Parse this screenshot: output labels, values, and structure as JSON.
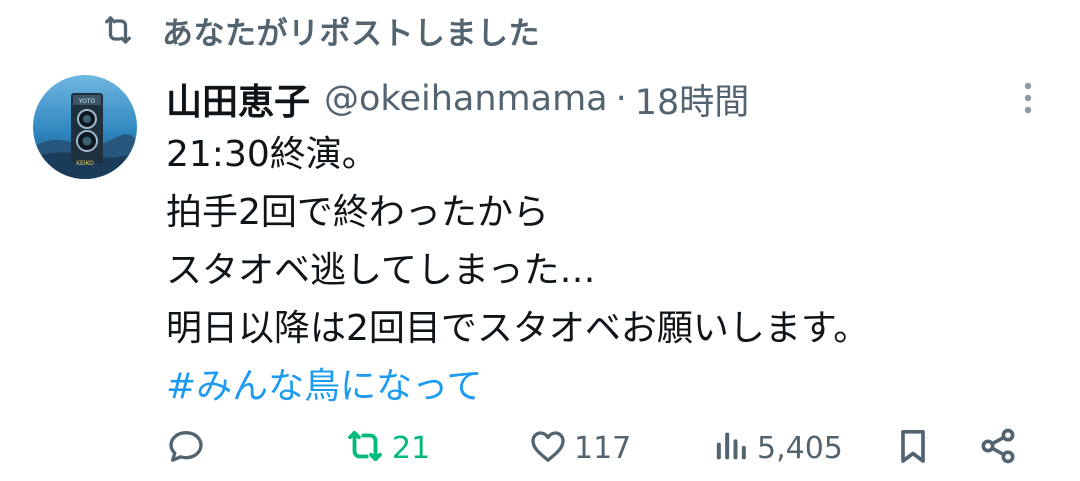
{
  "repost_banner": {
    "text": "あなたがリポストしました",
    "icon": "repost-icon"
  },
  "tweet": {
    "author": {
      "display_name": "山田恵子",
      "handle": "@okeihanmama",
      "avatar": "avatar-image"
    },
    "separator": "·",
    "time": "18時間",
    "lines": [
      "21:30終演。",
      "拍手2回で終わったから",
      "スタオベ逃してしまった…",
      "明日以降は2回目でスタオベお願いします。"
    ],
    "hashtag": "#みんな鳥になって",
    "more_icon": "more-vertical-icon"
  },
  "actions": {
    "reply": {
      "icon": "reply-icon",
      "count": ""
    },
    "retweet": {
      "icon": "retweet-icon",
      "count": "21",
      "active_color": "#00ba7c"
    },
    "like": {
      "icon": "heart-icon",
      "count": "117"
    },
    "views": {
      "icon": "views-icon",
      "count": "5,405"
    },
    "bookmark": {
      "icon": "bookmark-icon"
    },
    "share": {
      "icon": "share-icon"
    }
  },
  "colors": {
    "text": "#0f1419",
    "secondary": "#536471",
    "link": "#1d9bf0",
    "retweet_green": "#00ba7c"
  }
}
